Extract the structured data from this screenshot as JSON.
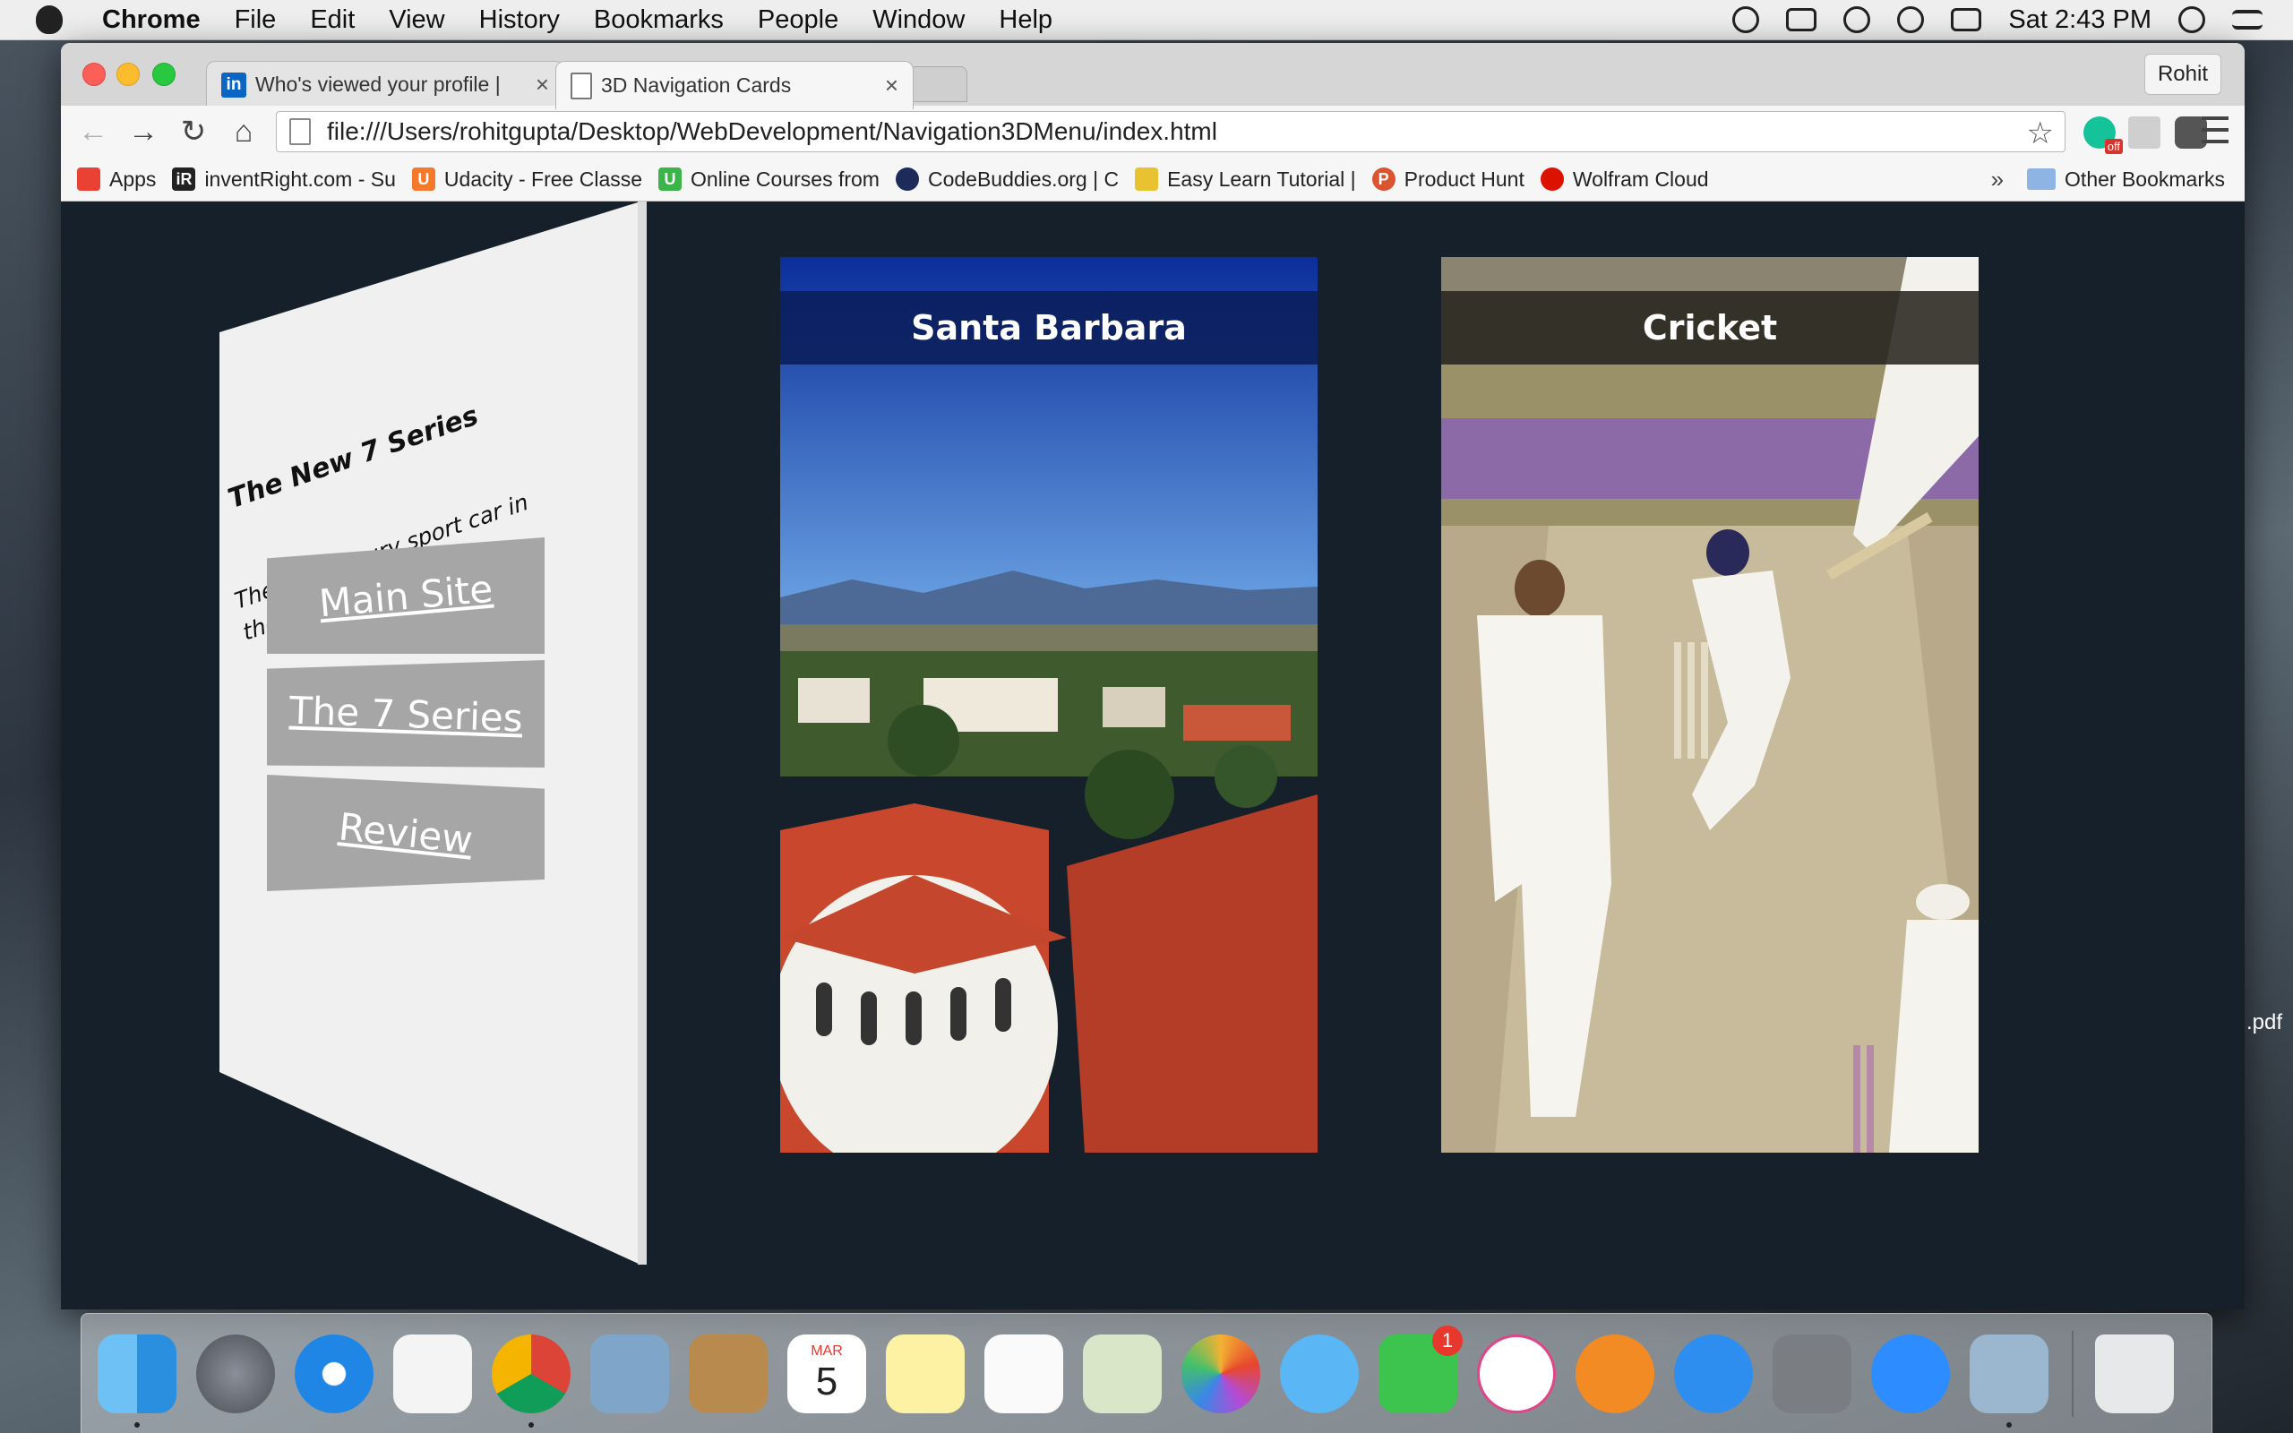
{
  "menubar": {
    "app_name": "Chrome",
    "menus": [
      "File",
      "Edit",
      "View",
      "History",
      "Bookmarks",
      "People",
      "Window",
      "Help"
    ],
    "clock": "Sat 2:43 PM",
    "status_icons": [
      "time-machine-icon",
      "airplay-icon",
      "bluetooth-icon",
      "wifi-icon",
      "battery-icon",
      "spotlight-icon",
      "notification-center-icon"
    ]
  },
  "browser": {
    "tabs": [
      {
        "label": "Who's viewed your profile |",
        "favicon": "linkedin-icon",
        "favicon_text": "in",
        "active": false
      },
      {
        "label": "3D Navigation Cards",
        "favicon": "document-icon",
        "active": true
      }
    ],
    "profile_name": "Rohit",
    "url": "file:///Users/rohitgupta/Desktop/WebDevelopment/Navigation3DMenu/index.html",
    "bookmarks": [
      {
        "label": "Apps",
        "icon": "apps-grid-icon",
        "icon_text": "",
        "color": "#e94235"
      },
      {
        "label": "inventRight.com - Su",
        "icon": "inventright-icon",
        "icon_text": "iR",
        "color": "#222222"
      },
      {
        "label": "Udacity - Free Classe",
        "icon": "udacity-icon",
        "icon_text": "U",
        "color": "#f5792a"
      },
      {
        "label": "Online Courses from",
        "icon": "udemy-icon",
        "icon_text": "U",
        "color": "#3bb54a"
      },
      {
        "label": "CodeBuddies.org | C",
        "icon": "codebuddies-icon",
        "icon_text": "",
        "color": "#1d2b5a"
      },
      {
        "label": "Easy Learn Tutorial |",
        "icon": "easylearn-icon",
        "icon_text": "",
        "color": "#e8c230"
      },
      {
        "label": "Product Hunt",
        "icon": "product-hunt-icon",
        "icon_text": "P",
        "color": "#da552f"
      },
      {
        "label": "Wolfram Cloud",
        "icon": "wolfram-icon",
        "icon_text": "",
        "color": "#dd1100"
      }
    ],
    "other_bookmarks": "Other Bookmarks"
  },
  "page": {
    "panel_heading": "The New 7 Series",
    "panel_text": "The best luxury sport car in the world.",
    "nav_buttons": [
      "Main Site",
      "The 7 Series",
      "Review"
    ],
    "cards": [
      {
        "title": "Santa Barbara",
        "image": "santa-barbara-rooftops-photo"
      },
      {
        "title": "Cricket",
        "image": "cricket-match-photo"
      }
    ]
  },
  "desktop": {
    "file_label": ".pdf"
  },
  "dock": {
    "apps": [
      "finder-icon",
      "launchpad-icon",
      "safari-icon",
      "app-grid-icon",
      "chrome-icon",
      "mail-icon",
      "contacts-icon",
      "calendar-icon",
      "notes-icon",
      "reminders-icon",
      "maps-icon",
      "photos-icon",
      "messages-icon",
      "facetime-icon",
      "itunes-icon",
      "ibooks-icon",
      "app-store-icon",
      "system-preferences-icon",
      "zoom-icon",
      "preview-icon",
      "trash-icon"
    ],
    "calendar_month": "MAR",
    "calendar_day": "5",
    "facetime_badge": "1"
  }
}
